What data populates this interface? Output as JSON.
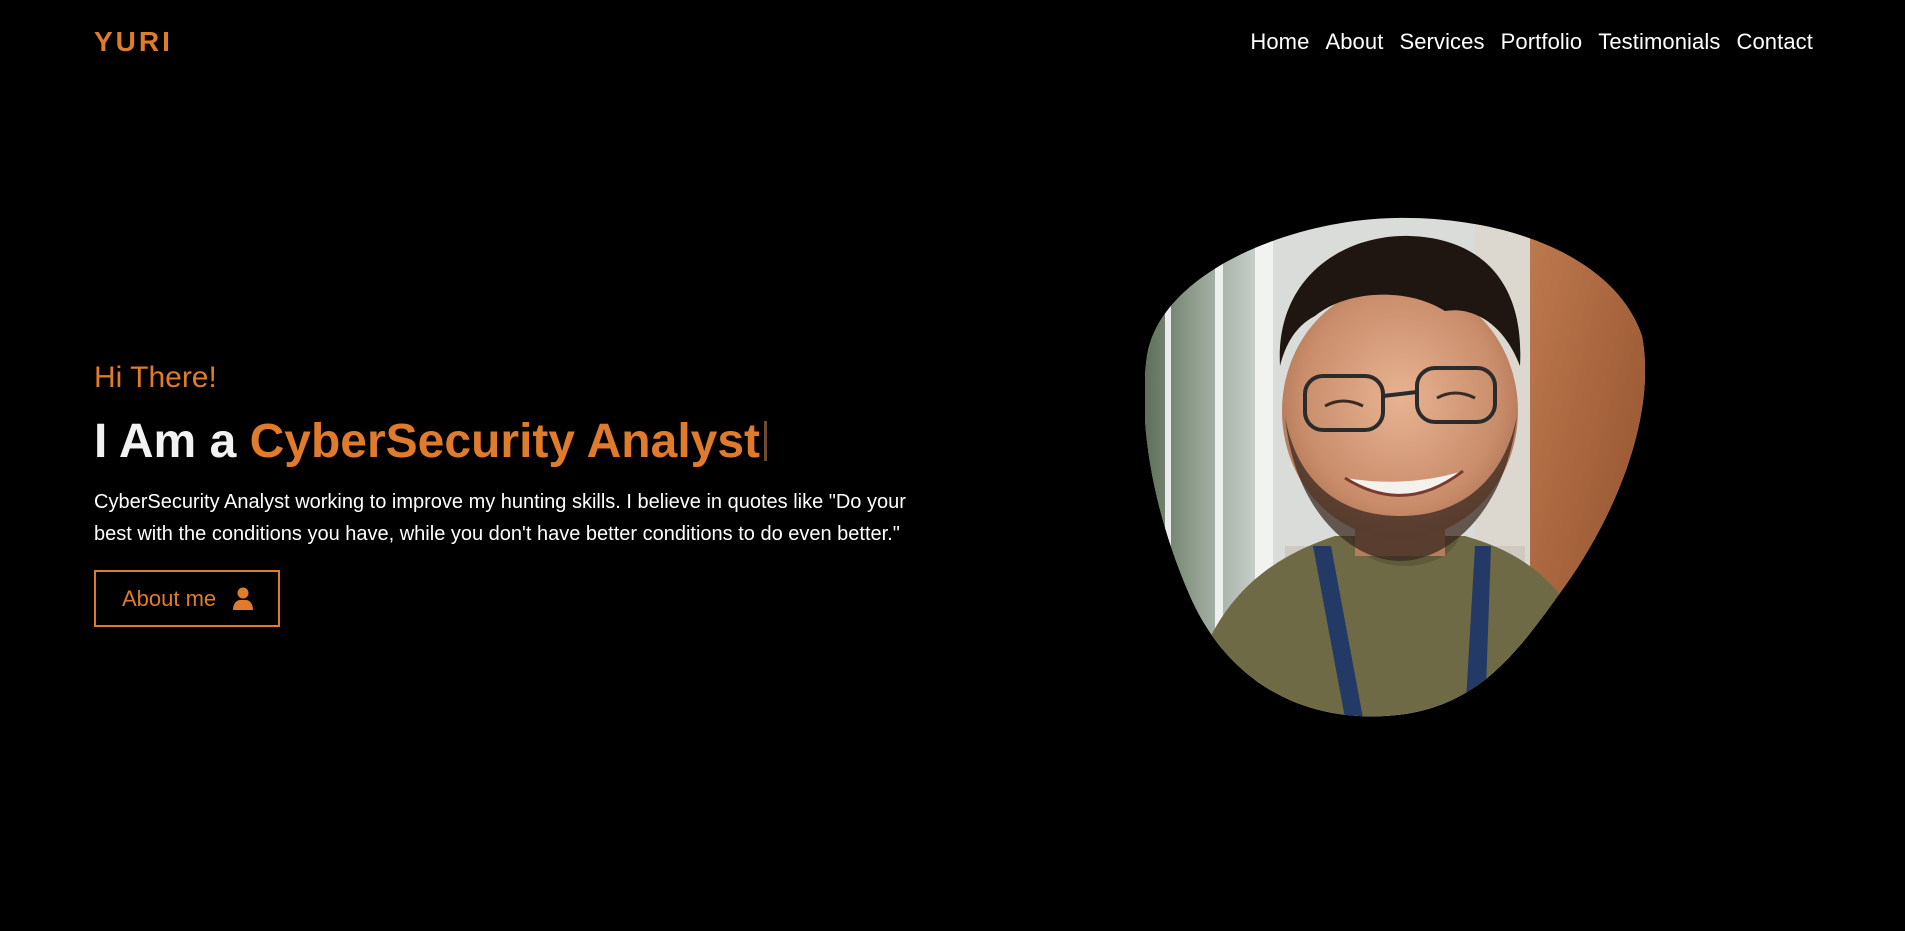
{
  "header": {
    "logo": "YURI",
    "nav": [
      {
        "label": "Home"
      },
      {
        "label": "About"
      },
      {
        "label": "Services"
      },
      {
        "label": "Portfolio"
      },
      {
        "label": "Testimonials"
      },
      {
        "label": "Contact"
      }
    ]
  },
  "hero": {
    "greeting": "Hi There!",
    "headline_prefix": "I Am a ",
    "headline_role": "CyberSecurity Analyst",
    "description": "CyberSecurity Analyst working to improve my hunting skills. I believe in quotes like \"Do your best with the conditions you have, while you don't have better conditions to do even better.\"",
    "button_label": "About me",
    "button_icon": "user-icon"
  },
  "profile_photo": {
    "icon": "profile-photo"
  },
  "colors": {
    "accent": "#e07b2c",
    "background": "#000000",
    "text": "#ffffff"
  }
}
